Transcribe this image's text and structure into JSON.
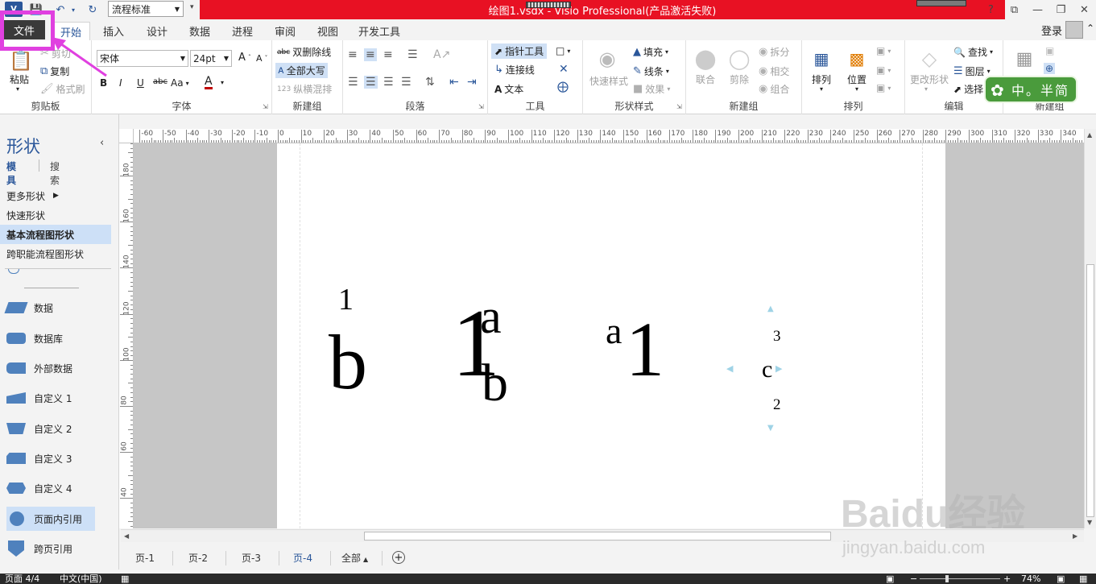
{
  "titlebar": {
    "style_select": "流程标准",
    "title": "绘图1.vsdx - Visio Professional(产品激活失败)"
  },
  "window_controls": {
    "help": "?",
    "restore_ribbon": "⧉",
    "minimize": "—",
    "maximize": "❐",
    "close": "✕"
  },
  "tabs": {
    "file": "文件",
    "items": [
      "开始",
      "插入",
      "设计",
      "数据",
      "进程",
      "审阅",
      "视图",
      "开发工具"
    ],
    "login": "登录"
  },
  "ribbon": {
    "clipboard": {
      "label": "剪贴板",
      "paste": "粘贴",
      "cut": "剪切",
      "copy": "复制",
      "format_painter": "格式刷"
    },
    "font": {
      "label": "字体",
      "name": "宋体",
      "size": "24pt",
      "bold": "B",
      "italic": "I",
      "underline": "U",
      "strike": "abc",
      "case": "Aa",
      "color": "A"
    },
    "new_group1": {
      "label": "新建组",
      "double_strike": "双删除线",
      "all_caps": "全部大写",
      "vertical": "纵横混排"
    },
    "paragraph": {
      "label": "段落"
    },
    "tools": {
      "label": "工具",
      "pointer": "指针工具",
      "connector": "连接线",
      "text": "文本"
    },
    "shape_style": {
      "label": "形状样式",
      "quick": "快速样式",
      "fill": "填充",
      "line": "线条",
      "effect": "效果"
    },
    "new_group2": {
      "label": "新建组",
      "union": "联合",
      "fragment": "剪除",
      "split": "拆分",
      "intersect": "相交",
      "combine": "组合"
    },
    "arrange": {
      "label": "排列",
      "arrange": "排列",
      "position": "位置"
    },
    "edit": {
      "label": "编辑",
      "change_shape": "更改形状",
      "find": "查找",
      "layers": "图层",
      "select": "选择"
    },
    "new_group3": {
      "label": "新建组"
    }
  },
  "stamp": {
    "text": "中。半简"
  },
  "shapes_pane": {
    "title": "形状",
    "tab_stencil": "模具",
    "tab_search": "搜索",
    "menu": [
      "更多形状",
      "快速形状",
      "基本流程图形状",
      "跨职能流程图形状"
    ],
    "shapes": [
      "数据",
      "数据库",
      "外部数据",
      "自定义 1",
      "自定义 2",
      "自定义 3",
      "自定义 4",
      "页面内引用",
      "跨页引用"
    ]
  },
  "rulers": {
    "h_labels": [
      "-60",
      "-50",
      "-40",
      "-30",
      "-20",
      "-10",
      "0",
      "10",
      "20",
      "30",
      "40",
      "50",
      "60",
      "70",
      "80",
      "90",
      "100",
      "110",
      "120",
      "130",
      "140",
      "150",
      "160",
      "170",
      "180",
      "190",
      "200",
      "210",
      "220",
      "230",
      "240",
      "250",
      "260",
      "270",
      "280",
      "290",
      "300",
      "310",
      "320",
      "330",
      "340"
    ],
    "v_labels": [
      "180",
      "160",
      "140",
      "120",
      "100",
      "80",
      "60",
      "40"
    ]
  },
  "canvas": {
    "g1_sup": "1",
    "g1_base": "b",
    "g2_base": "1",
    "g2_sup": "a",
    "g2_sub": "b",
    "g3_sup": "a",
    "g3_base": "1",
    "g4_top": "3",
    "g4_mid": "c",
    "g4_bot": "2"
  },
  "page_tabs": [
    "页-1",
    "页-2",
    "页-3",
    "页-4"
  ],
  "page_tab_all": "全部",
  "page_tab_add": "+",
  "status": {
    "page": "页面 4/4",
    "lang": "中文(中国)",
    "zoom": "74%"
  },
  "watermark": {
    "brand": "Baidu经验",
    "url": "jingyan.baidu.com"
  }
}
